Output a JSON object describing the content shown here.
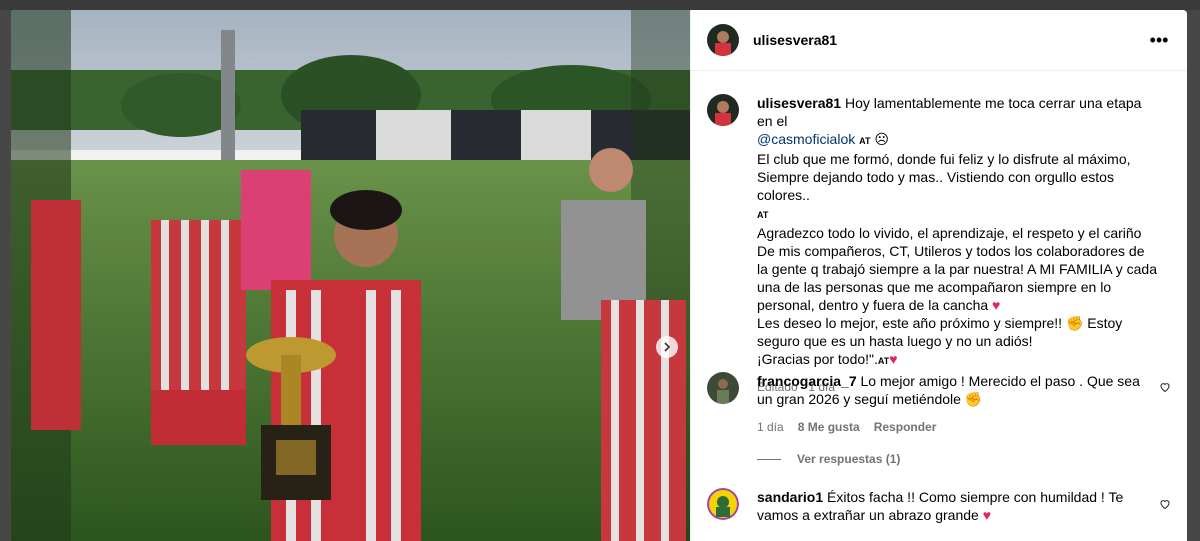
{
  "post": {
    "author": "ulisesvera81",
    "caption_lines": [
      {
        "before": "Hoy lamentablemente me toca cerrar una etapa en el "
      },
      {
        "mention": "@casmoficialok"
      },
      {
        "text": "El club que me formó, donde fui feliz y lo disfrute al máximo, Siempre dejando todo y mas.. Vistiendo con orgullo estos colores.."
      },
      {
        "text": "Agradezco todo lo vivido, el aprendizaje, el respeto y el cariño De mis compañeros, CT, Utileros y todos los colaboradores de la gente q trabajó siempre a la par nuestra! A MI FAMILIA y cada una de las personas que me acompañaron siempre en lo personal, dentro y fuera de la cancha"
      },
      {
        "text": "Les deseo lo mejor, este año próximo y siempre!!"
      },
      {
        "text": " Estoy seguro que es un hasta luego y no un adiós!"
      },
      {
        "text": "¡Gracias por todo!\"."
      }
    ],
    "at_label": "AT",
    "edited": "Editado · 1 día"
  },
  "comments": [
    {
      "user": "francogarcia_7",
      "text": "Lo mejor amigo ! Merecido el paso . Que sea un gran 2026 y seguí metiéndole",
      "time": "1 día",
      "likes": "8 Me gusta",
      "reply": "Responder"
    },
    {
      "user": "sandario1",
      "text": "Éxitos facha !! Como siempre con humildad ! Te vamos a extrañar un abrazo grande"
    }
  ],
  "replies_label": "Ver respuestas (1)",
  "colors": {
    "accent_link": "#00376b",
    "muted": "#737373",
    "heart": "#e0245e"
  },
  "icons": [
    "more-options-icon",
    "chevron-right-icon",
    "heart-outline-icon",
    "sad-face-emoji",
    "red-heart-emoji",
    "flexed-biceps-emoji"
  ]
}
